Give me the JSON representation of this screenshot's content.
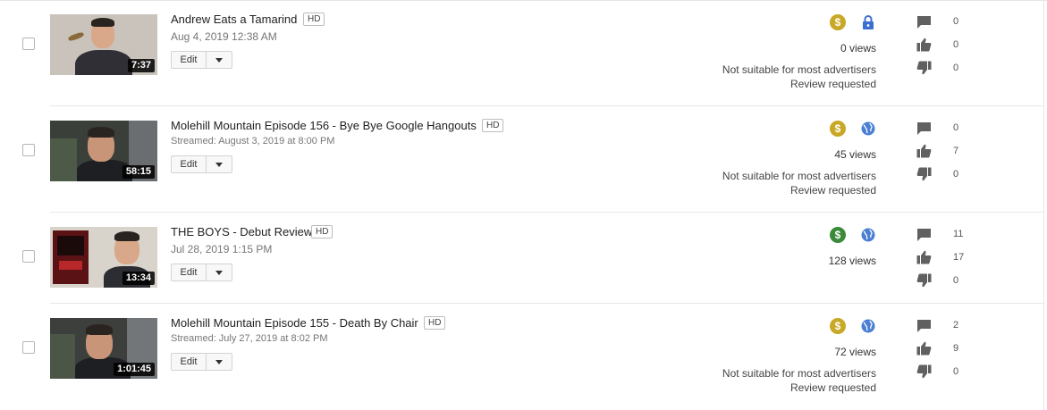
{
  "colors": {
    "monetized_yellow": "#c8a825",
    "monetized_green": "#3a8a3a",
    "public_blue": "#4a7fd4",
    "private_blue": "#3b6fd0"
  },
  "videos": [
    {
      "title": "Andrew Eats a Tamarind",
      "hd": "HD",
      "date": "Aug 4, 2019 12:38 AM",
      "duration": "7:37",
      "edit_label": "Edit",
      "monetization_icon": "dollar-icon",
      "monetization_color": "#c8a825",
      "visibility_icon": "lock-icon",
      "views": "0 views",
      "ad_status": "Not suitable for most advertisers",
      "review_status": "Review requested",
      "comments": "0",
      "likes": "0",
      "dislikes": "0"
    },
    {
      "title": "Molehill Mountain Episode 156 - Bye Bye Google Hangouts",
      "hd": "HD",
      "date": "Streamed: August 3, 2019 at 8:00 PM",
      "duration": "58:15",
      "edit_label": "Edit",
      "monetization_icon": "dollar-icon",
      "monetization_color": "#c8a825",
      "visibility_icon": "globe-icon",
      "views": "45 views",
      "ad_status": "Not suitable for most advertisers",
      "review_status": "Review requested",
      "comments": "0",
      "likes": "7",
      "dislikes": "0"
    },
    {
      "title": "THE BOYS - Debut Review",
      "hd": "HD",
      "date": "Jul 28, 2019 1:15 PM",
      "duration": "13:34",
      "edit_label": "Edit",
      "monetization_icon": "dollar-icon",
      "monetization_color": "#3a8a3a",
      "visibility_icon": "globe-icon",
      "views": "128 views",
      "ad_status": "",
      "review_status": "",
      "comments": "11",
      "likes": "17",
      "dislikes": "0"
    },
    {
      "title": "Molehill Mountain Episode 155 - Death By Chair",
      "hd": "HD",
      "date": "Streamed: July 27, 2019 at 8:02 PM",
      "duration": "1:01:45",
      "edit_label": "Edit",
      "monetization_icon": "dollar-icon",
      "monetization_color": "#c8a825",
      "visibility_icon": "globe-icon",
      "views": "72 views",
      "ad_status": "Not suitable for most advertisers",
      "review_status": "Review requested",
      "comments": "2",
      "likes": "9",
      "dislikes": "0"
    }
  ]
}
